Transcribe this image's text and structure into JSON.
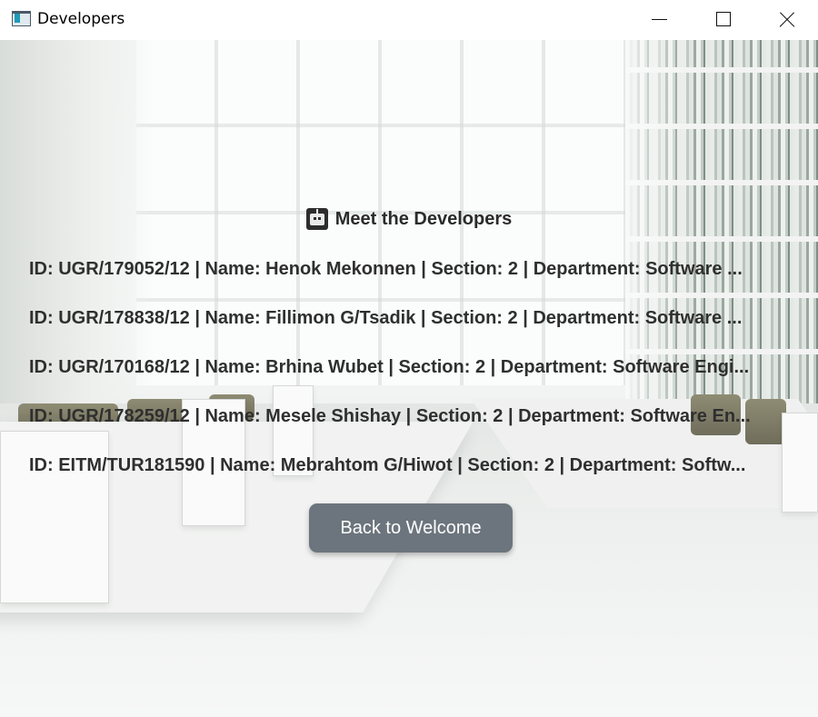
{
  "window": {
    "title": "Developers"
  },
  "heading": {
    "icon": "robot-icon",
    "text": "Meet the Developers"
  },
  "developers": [
    "ID: UGR/179052/12 | Name: Henok Mekonnen | Section: 2 | Department: Software ...",
    "ID: UGR/178838/12 | Name: Fillimon G/Tsadik | Section: 2 | Department: Software ...",
    "ID: UGR/170168/12 | Name: Brhina Wubet | Section: 2 | Department: Software Engi...",
    "ID: UGR/178259/12 | Name: Mesele Shishay | Section: 2 | Department: Software En...",
    "ID: EITM/TUR181590 | Name: Mebrahtom G/Hiwot | Section: 2 | Department: Softw..."
  ],
  "back_button": {
    "label": "Back to Welcome"
  },
  "colors": {
    "button_bg": "#6c757d",
    "text": "#2f2f2f"
  }
}
